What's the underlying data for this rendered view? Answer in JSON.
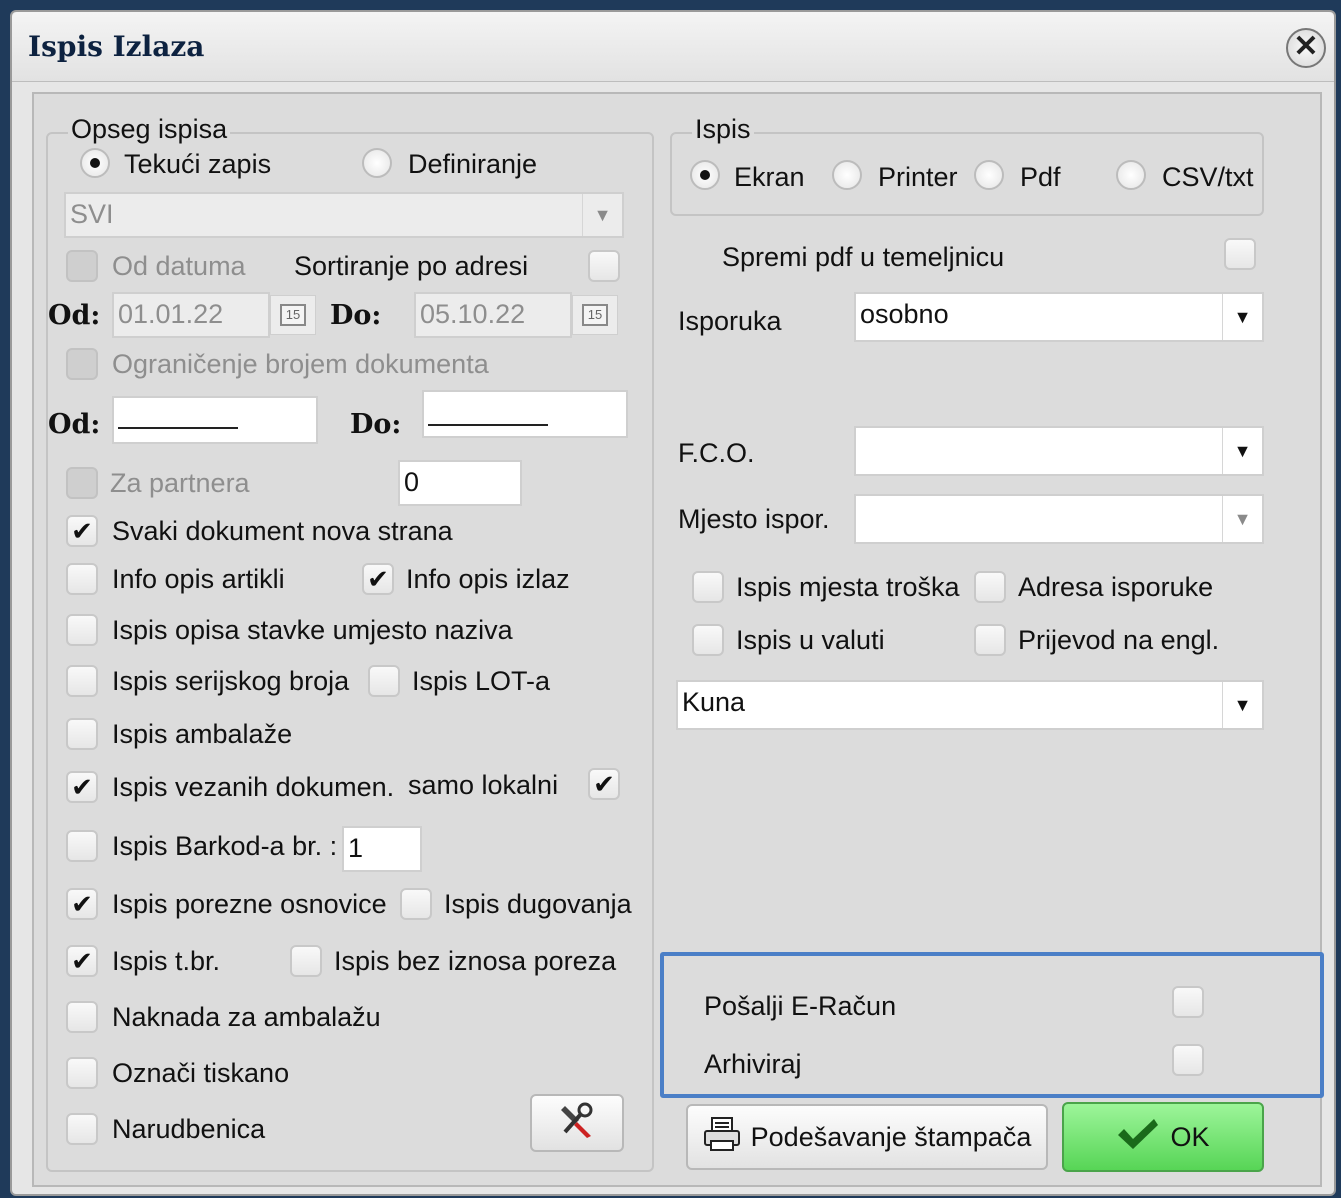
{
  "window": {
    "title": "Ispis Izlaza",
    "close_label": "✕"
  },
  "scope": {
    "legend": "Opseg ispisa",
    "radio_current": "Tekući zapis",
    "radio_define": "Definiranje",
    "combo_value": "SVI",
    "from_date_label": "Od datuma",
    "sort_address_label": "Sortiranje po adresi",
    "od_label": "Od:",
    "do_label": "Do:",
    "date_from": "01.01.22",
    "date_to": "05.10.22",
    "calendar_label": "15",
    "limit_doc_label": "Ograničenje brojem dokumenta",
    "partner_label": "Za partnera",
    "partner_value": "0"
  },
  "options": {
    "each_doc_new_page": "Svaki dokument nova strana",
    "info_items": "Info opis artikli",
    "info_output": "Info opis izlaz",
    "item_desc_instead": "Ispis opisa stavke umjesto naziva",
    "serial": "Ispis serijskog broja",
    "lot": "Ispis LOT-a",
    "packaging": "Ispis ambalaže",
    "linked_docs": "Ispis vezanih dokumen.",
    "local_only": "samo lokalni",
    "barcode": "Ispis Barkod-a br. :",
    "barcode_value": "1",
    "tax_base": "Ispis porezne osnovice",
    "debt": "Ispis dugovanja",
    "tbr": "Ispis t.br.",
    "no_tax": "Ispis bez iznosa poreza",
    "pack_fee": "Naknada za ambalažu",
    "mark_printed": "Označi tiskano",
    "order": "Narudbenica"
  },
  "print": {
    "legend": "Ispis",
    "screen": "Ekran",
    "printer": "Printer",
    "pdf": "Pdf",
    "csv": "CSV/txt",
    "save_pdf": "Spremi pdf u temeljnicu",
    "delivery_label": "Isporuka",
    "delivery_value": "osobno",
    "fco_label": "F.C.O.",
    "fco_value": "",
    "place_label": "Mjesto ispor.",
    "place_value": "",
    "cost_place": "Ispis mjesta troška",
    "delivery_address": "Adresa isporuke",
    "in_currency": "Ispis u valuti",
    "translate_en": "Prijevod na engl.",
    "currency_value": "Kuna",
    "send_einvoice": "Pošalji E-Račun",
    "archive": "Arhiviraj",
    "printer_setup": "Podešavanje štampača",
    "ok": "OK"
  },
  "colors": {
    "highlight": "#4b7fc7",
    "ok_green": "#57d556",
    "title": "#0d2240"
  }
}
